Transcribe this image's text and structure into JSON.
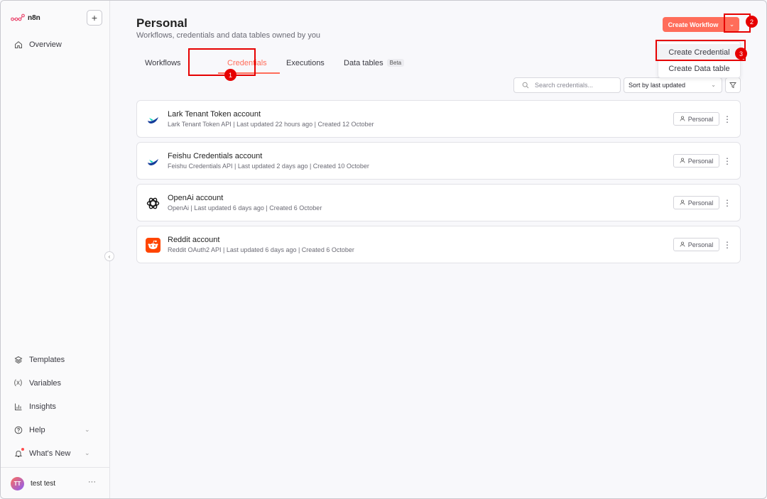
{
  "sidebar": {
    "logo_text": "n8n",
    "plus_label": "+",
    "overview": "Overview",
    "templates": "Templates",
    "variables": "Variables",
    "insights": "Insights",
    "help": "Help",
    "whats_new": "What's New",
    "collapse": "‹",
    "user": {
      "initials": "TT",
      "name": "test test",
      "menu": "···"
    }
  },
  "header": {
    "title": "Personal",
    "subtitle": "Workflows, credentials and data tables owned by you",
    "create_workflow": "Create Workflow",
    "dropdown_chevron": "⌄"
  },
  "dropdown_menu": {
    "items": [
      "Create Credential",
      "Create Data table"
    ]
  },
  "tabs": {
    "workflows": "Workflows",
    "credentials": "Credentials",
    "executions": "Executions",
    "data_tables": "Data tables",
    "beta": "Beta",
    "active": "Credentials"
  },
  "toolbar": {
    "search_placeholder": "Search credentials...",
    "sort_label": "Sort by last updated",
    "sort_chevron": "⌄"
  },
  "credentials": [
    {
      "name": "Lark Tenant Token account",
      "meta": "Lark Tenant Token API | Last updated 22 hours ago | Created 12 October",
      "badge": "Personal",
      "icon": "lark-icon"
    },
    {
      "name": "Feishu Credentials account",
      "meta": "Feishu Credentials API | Last updated 2 days ago | Created 10 October",
      "badge": "Personal",
      "icon": "feishu-icon"
    },
    {
      "name": "OpenAi account",
      "meta": "OpenAi | Last updated 6 days ago | Created 6 October",
      "badge": "Personal",
      "icon": "openai-icon"
    },
    {
      "name": "Reddit account",
      "meta": "Reddit OAuth2 API | Last updated 6 days ago | Created 6 October",
      "badge": "Personal",
      "icon": "reddit-icon"
    }
  ],
  "annotations": [
    "1",
    "2",
    "3"
  ],
  "colors": {
    "accent": "#ff6d5a",
    "annotation": "#e60000"
  }
}
